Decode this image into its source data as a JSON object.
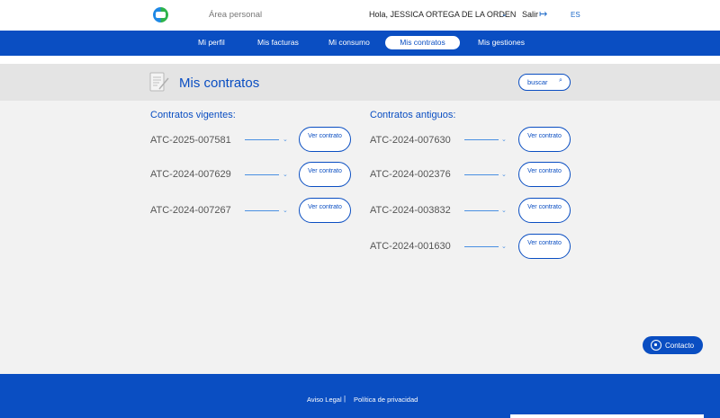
{
  "header": {
    "area_label": "Área personal",
    "greeting": "Hola, JESSICA ORTEGA DE LA ORDEN",
    "logout_label": "Salir",
    "language": "ES"
  },
  "nav": {
    "items": [
      {
        "label": "Mi perfil"
      },
      {
        "label": "Mis facturas"
      },
      {
        "label": "Mi consumo"
      },
      {
        "label": "Mis contratos"
      },
      {
        "label": "Mis gestiones"
      }
    ],
    "active": "Mis contratos"
  },
  "page": {
    "title": "Mis contratos",
    "search_label": "buscar"
  },
  "current_contracts": {
    "title": "Contratos vigentes:",
    "items": [
      {
        "id": "ATC-2025-007581",
        "button": "Ver contrato"
      },
      {
        "id": "ATC-2024-007629",
        "button": "Ver contrato"
      },
      {
        "id": "ATC-2024-007267",
        "button": "Ver contrato"
      }
    ]
  },
  "old_contracts": {
    "title": "Contratos antiguos:",
    "items": [
      {
        "id": "ATC-2024-007630",
        "button": "Ver contrato"
      },
      {
        "id": "ATC-2024-002376",
        "button": "Ver contrato"
      },
      {
        "id": "ATC-2024-003832",
        "button": "Ver contrato"
      },
      {
        "id": "ATC-2024-001630",
        "button": "Ver contrato"
      }
    ]
  },
  "contact_button": "Contacto",
  "footer": {
    "legal": "Aviso Legal",
    "separator": "|",
    "privacy": "Política de privacidad"
  },
  "colors": {
    "brand_blue": "#0a4ec2",
    "background": "#f2f2f2",
    "title_bar": "#e4e4e4"
  }
}
